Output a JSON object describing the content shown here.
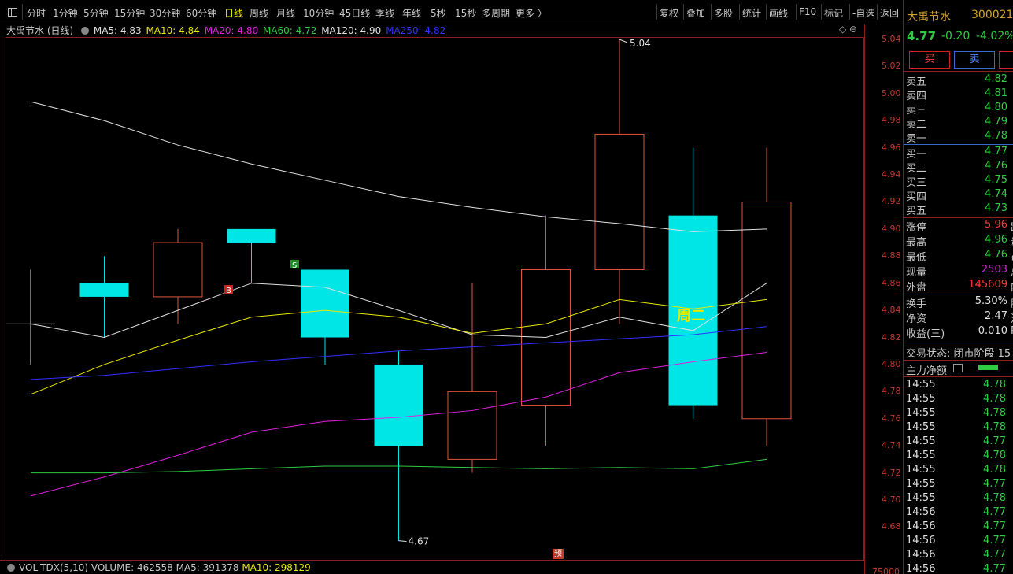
{
  "toolbar": {
    "periods": [
      "分时",
      "1分钟",
      "5分钟",
      "15分钟",
      "30分钟",
      "60分钟",
      "日线",
      "周线",
      "月线",
      "10分钟",
      "45日线",
      "季线",
      "年线",
      "5秒",
      "15秒",
      "多周期",
      "更多 〉"
    ],
    "active_period": "日线",
    "tools": [
      "复权",
      "叠加",
      "多股",
      "统计",
      "画线",
      "F10",
      "标记",
      "-自选",
      "返回"
    ]
  },
  "legend": {
    "name": "大禹节水 (日线)",
    "ma5": "MA5: 4.83",
    "ma10": "MA10: 4.84",
    "ma20": "MA20: 4.80",
    "ma60": "MA60: 4.72",
    "ma120": "MA120: 4.90",
    "ma250": "MA250: 4.82",
    "colors": {
      "ma5": "#e0e0e0",
      "ma10": "#e8e800",
      "ma20": "#e020e0",
      "ma60": "#2ecc40",
      "ma120": "#e0e0e0",
      "ma250": "#3030ff"
    }
  },
  "axis_controls": "◇ ⊖",
  "chart_data": {
    "type": "candlestick",
    "ylim": [
      4.66,
      5.05
    ],
    "y_ticks": [
      "5.04",
      "5.02",
      "5.00",
      "4.98",
      "4.96",
      "4.94",
      "4.92",
      "4.90",
      "4.88",
      "4.86",
      "4.84",
      "4.82",
      "4.80",
      "4.78",
      "4.76",
      "4.74",
      "4.72",
      "4.70",
      "4.68"
    ],
    "candles": [
      {
        "open": 4.83,
        "close": 4.83,
        "high": 4.87,
        "low": 4.8
      },
      {
        "open": 4.86,
        "close": 4.85,
        "high": 4.88,
        "low": 4.82
      },
      {
        "open": 4.85,
        "close": 4.89,
        "high": 4.9,
        "low": 4.83
      },
      {
        "open": 4.9,
        "close": 4.89,
        "high": 4.9,
        "low": 4.86
      },
      {
        "open": 4.87,
        "close": 4.82,
        "high": 4.87,
        "low": 4.8
      },
      {
        "open": 4.8,
        "close": 4.74,
        "high": 4.81,
        "low": 4.67
      },
      {
        "open": 4.73,
        "close": 4.78,
        "high": 4.86,
        "low": 4.72
      },
      {
        "open": 4.77,
        "close": 4.87,
        "high": 4.91,
        "low": 4.74
      },
      {
        "open": 4.87,
        "close": 4.97,
        "high": 5.04,
        "low": 4.83
      },
      {
        "open": 4.91,
        "close": 4.77,
        "high": 4.96,
        "low": 4.76
      },
      {
        "open": 4.76,
        "close": 4.92,
        "high": 4.96,
        "low": 4.74
      }
    ],
    "ma_lines": {
      "ma5": [
        4.83,
        4.82,
        4.84,
        4.86,
        4.857,
        4.84,
        4.822,
        4.82,
        4.835,
        4.825,
        4.86
      ],
      "ma10": [
        4.778,
        4.8,
        4.818,
        4.835,
        4.84,
        4.835,
        4.823,
        4.83,
        4.848,
        4.841,
        4.848
      ],
      "ma20": [
        4.703,
        4.717,
        4.733,
        4.75,
        4.758,
        4.761,
        4.766,
        4.776,
        4.794,
        4.802,
        4.809
      ],
      "ma60": [
        4.72,
        4.72,
        4.721,
        4.723,
        4.725,
        4.725,
        4.724,
        4.723,
        4.724,
        4.723,
        4.73
      ],
      "ma120": [
        4.994,
        4.98,
        4.962,
        4.948,
        4.936,
        4.924,
        4.916,
        4.909,
        4.904,
        4.898,
        4.9
      ],
      "ma250": [
        4.789,
        4.792,
        4.797,
        4.802,
        4.806,
        4.81,
        4.813,
        4.816,
        4.819,
        4.822,
        4.828
      ]
    },
    "annotations": {
      "high_label": "5.04",
      "low_label": "4.67",
      "sell_marker": "S",
      "buy_marker": "B",
      "weekday": "周二"
    }
  },
  "volume": {
    "text_prefix": "VOL-TDX(5,10)",
    "volume": "VOLUME: 462558",
    "ma5": "MA5: 391378",
    "ma10": "MA10: 298129",
    "axis_label": "75000",
    "pre_badge": "预"
  },
  "stock": {
    "name": "大禹节水",
    "code": "300021",
    "price": "4.77",
    "change": "-0.20",
    "change_pct": "-4.02%",
    "buy_label": "买",
    "sell_label": "卖"
  },
  "order_book": {
    "asks": [
      {
        "label": "卖五",
        "price": "4.82"
      },
      {
        "label": "卖四",
        "price": "4.81"
      },
      {
        "label": "卖三",
        "price": "4.80"
      },
      {
        "label": "卖二",
        "price": "4.79"
      },
      {
        "label": "卖一",
        "price": "4.78"
      }
    ],
    "bids": [
      {
        "label": "买一",
        "price": "4.77"
      },
      {
        "label": "买二",
        "price": "4.76"
      },
      {
        "label": "买三",
        "price": "4.75"
      },
      {
        "label": "买四",
        "price": "4.74"
      },
      {
        "label": "买五",
        "price": "4.73"
      }
    ]
  },
  "quote": {
    "rows1": [
      {
        "label": "涨停",
        "value": "5.96",
        "cut": "跌"
      },
      {
        "label": "最高",
        "value": "4.96",
        "cut": "量"
      },
      {
        "label": "最低",
        "value": "4.76",
        "cut": "市"
      },
      {
        "label": "现量",
        "value": "2503",
        "cut": "总"
      },
      {
        "label": "外盘",
        "value": "145609",
        "cut": "内"
      }
    ],
    "rows2": [
      {
        "label": "换手",
        "value": "5.30%",
        "cut": "股"
      },
      {
        "label": "净资",
        "value": "2.47",
        "cut": "流"
      },
      {
        "label": "收益(三)",
        "value": "0.010",
        "cut": "PE"
      }
    ]
  },
  "trade_status": "交易状态: 闭市阶段 15",
  "netflow_label": "主力净额",
  "ticks": [
    {
      "time": "14:55",
      "price": "4.78"
    },
    {
      "time": "14:55",
      "price": "4.78"
    },
    {
      "time": "14:55",
      "price": "4.78"
    },
    {
      "time": "14:55",
      "price": "4.78"
    },
    {
      "time": "14:55",
      "price": "4.77"
    },
    {
      "time": "14:55",
      "price": "4.78"
    },
    {
      "time": "14:55",
      "price": "4.78"
    },
    {
      "time": "14:55",
      "price": "4.77"
    },
    {
      "time": "14:55",
      "price": "4.78"
    },
    {
      "time": "14:56",
      "price": "4.77"
    },
    {
      "time": "14:56",
      "price": "4.77"
    },
    {
      "time": "14:56",
      "price": "4.77"
    },
    {
      "time": "14:56",
      "price": "4.77"
    },
    {
      "time": "14:56",
      "price": "4.77"
    }
  ]
}
